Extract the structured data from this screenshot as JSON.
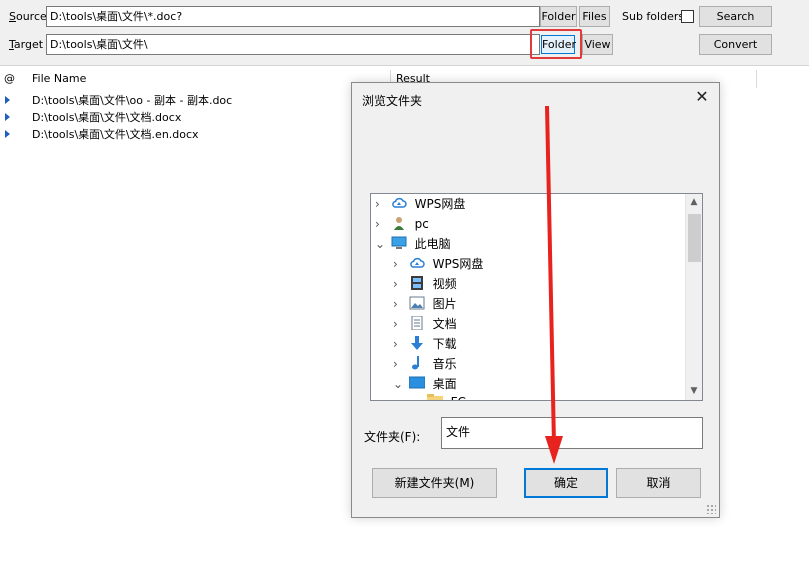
{
  "toolbar": {
    "source_label_prefix": "",
    "source_label_ul": "S",
    "source_label_rest": "ource",
    "source_value": "D:\\tools\\桌面\\文件\\*.doc?",
    "source_folder_btn": "Folder",
    "source_files_btn": "Files",
    "subfolders_label": "Sub folders",
    "search_btn": "Search",
    "target_label_ul": "T",
    "target_label_rest": "arget",
    "target_value": "D:\\tools\\桌面\\文件\\",
    "target_folder_btn": "Folder",
    "target_view_btn": "View",
    "convert_btn": "Convert"
  },
  "list": {
    "columns": {
      "at": "@",
      "file_name": "File Name",
      "result": "Result"
    },
    "rows": [
      "D:\\tools\\桌面\\文件\\oo - 副本 - 副本.doc",
      "D:\\tools\\桌面\\文件\\文档.docx",
      "D:\\tools\\桌面\\文件\\文档.en.docx"
    ]
  },
  "dialog": {
    "title": "浏览文件夹",
    "close": "✕",
    "tree": [
      {
        "label": "WPS网盘",
        "icon": "cloud-icon",
        "expanded": false
      },
      {
        "label": "pc",
        "icon": "user-icon",
        "expanded": false
      },
      {
        "label": "此电脑",
        "icon": "computer-icon",
        "expanded": true
      },
      {
        "label": "WPS网盘",
        "icon": "cloud-icon",
        "expanded": false
      },
      {
        "label": "视频",
        "icon": "video-icon",
        "expanded": false
      },
      {
        "label": "图片",
        "icon": "picture-icon",
        "expanded": false
      },
      {
        "label": "文档",
        "icon": "document-icon",
        "expanded": false
      },
      {
        "label": "下载",
        "icon": "download-icon",
        "expanded": false
      },
      {
        "label": "音乐",
        "icon": "music-icon",
        "expanded": false
      },
      {
        "label": "桌面",
        "icon": "desktop-icon",
        "expanded": true
      },
      {
        "label": "FC",
        "icon": "folder-icon",
        "expanded": false
      }
    ],
    "folder_label": "文件夹(F):",
    "folder_value": "文件",
    "new_folder_btn": "新建文件夹(M)",
    "ok_btn": "确定",
    "cancel_btn": "取消"
  },
  "colors": {
    "annotation_red": "#e8231f",
    "accent_blue": "#0078d7"
  }
}
